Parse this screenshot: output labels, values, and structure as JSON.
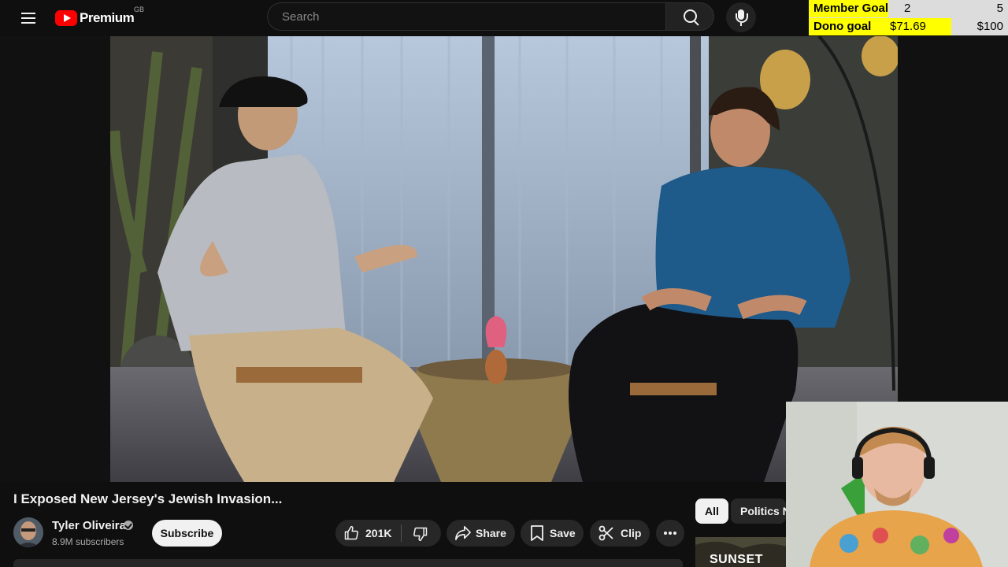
{
  "masthead": {
    "logo_text": "Premium",
    "country_code": "GB",
    "search_placeholder": "Search",
    "icons": [
      "menu-icon",
      "youtube-logo-icon",
      "search-icon",
      "microphone-icon"
    ]
  },
  "goal_overlay": {
    "member": {
      "label": "Member Goal",
      "current": "2",
      "target": "5",
      "progress": 0.4
    },
    "dono": {
      "label": "Dono goal",
      "current": "$71.69",
      "target": "$100",
      "progress": 0.7169
    },
    "colors": {
      "fill": "#ffff00",
      "track": "#dcdcdc"
    }
  },
  "video": {
    "title": "I Exposed New Jersey's Jewish Invasion..."
  },
  "channel": {
    "name": "Tyler Oliveira",
    "subscribers": "8.9M subscribers",
    "verified": true
  },
  "actions": {
    "subscribe": "Subscribe",
    "like_count": "201K",
    "share": "Share",
    "save": "Save",
    "clip": "Clip",
    "icons": [
      "thumbs-up-icon",
      "thumbs-down-icon",
      "share-icon",
      "bookmark-icon",
      "scissors-icon",
      "more-icon"
    ]
  },
  "chips": [
    "All",
    "Politics N"
  ],
  "recommendation": {
    "thumb_text": "SUNSET"
  },
  "colors": {
    "background": "#0f0f0f",
    "pill": "#272727",
    "text": "#f1f1f1",
    "subtext": "#aaaaaa",
    "brand_red": "#ff0000"
  }
}
